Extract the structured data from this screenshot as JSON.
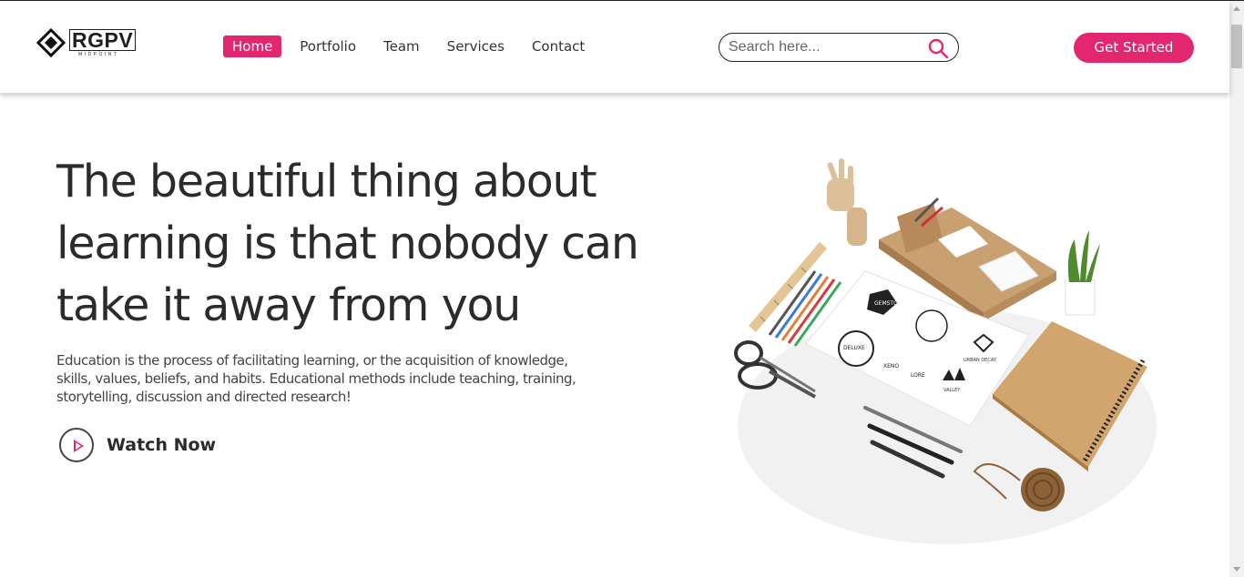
{
  "brand": {
    "name": "RGPV",
    "tagline": "MIDPOINT"
  },
  "nav": {
    "items": [
      {
        "label": "Home",
        "active": true
      },
      {
        "label": "Portfolio",
        "active": false
      },
      {
        "label": "Team",
        "active": false
      },
      {
        "label": "Services",
        "active": false
      },
      {
        "label": "Contact",
        "active": false
      }
    ]
  },
  "search": {
    "placeholder": "Search here...",
    "value": ""
  },
  "cta": {
    "label": "Get Started"
  },
  "hero": {
    "title": "The beautiful thing about learning is that nobody can take it away from you",
    "text": "Education is the process of facilitating learning, or the acquisition of knowledge, skills, values, beliefs, and habits. Educational methods include teaching, training, storytelling, discussion and directed research!",
    "watch_label": "Watch Now"
  },
  "illustration": {
    "stamps": [
      "GEMSTONE",
      "DELUXE",
      "XENO",
      "LORE",
      "URBAN DECAY",
      "VALLEY"
    ]
  },
  "colors": {
    "accent": "#e32670",
    "text": "#2b2b2b",
    "wood": "#c9a070"
  }
}
